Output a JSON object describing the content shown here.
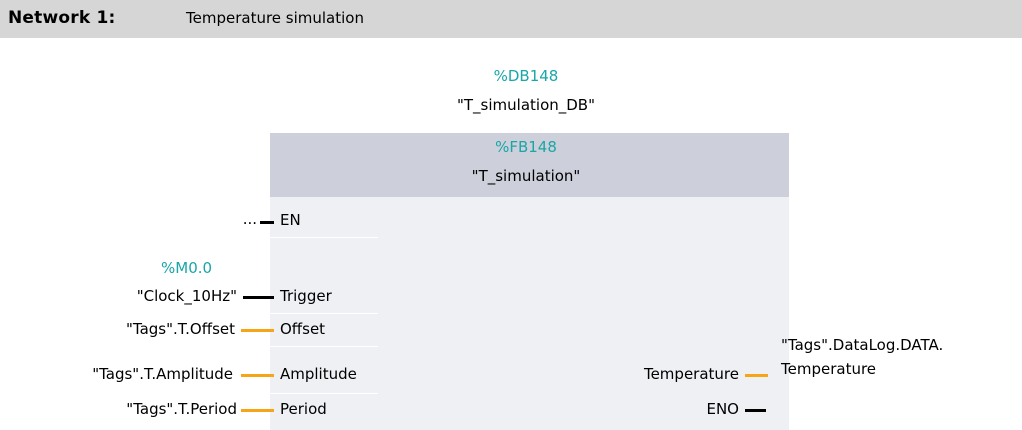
{
  "network": {
    "title": "Network 1:",
    "description": "Temperature simulation"
  },
  "instance_db": {
    "address": "%DB148",
    "name": "\"T_simulation_DB\""
  },
  "function_block": {
    "address": "%FB148",
    "name": "\"T_simulation\""
  },
  "inputs": [
    {
      "pin": "EN",
      "operand": "...",
      "address": "",
      "type": "bool"
    },
    {
      "pin": "Trigger",
      "operand": "\"Clock_10Hz\"",
      "address": "%M0.0",
      "type": "bool"
    },
    {
      "pin": "Offset",
      "operand": "\"Tags\".T.Offset",
      "address": "",
      "type": "numeric"
    },
    {
      "pin": "Amplitude",
      "operand": "\"Tags\".T.Amplitude",
      "address": "",
      "type": "numeric"
    },
    {
      "pin": "Period",
      "operand": "\"Tags\".T.Period",
      "address": "",
      "type": "numeric"
    }
  ],
  "outputs": [
    {
      "pin": "Temperature",
      "operand_line1": "\"Tags\".DataLog.DATA.",
      "operand_line2": "Temperature",
      "type": "numeric"
    },
    {
      "pin": "ENO",
      "operand_line1": "",
      "operand_line2": "",
      "type": "bool"
    }
  ],
  "colors": {
    "header_bar": "#d6d6d6",
    "block_header": "#cdd0da",
    "block_body": "#eef0f4",
    "address_text": "#1aa6a6",
    "bool_wire": "#000000",
    "numeric_wire": "#f7a417"
  }
}
